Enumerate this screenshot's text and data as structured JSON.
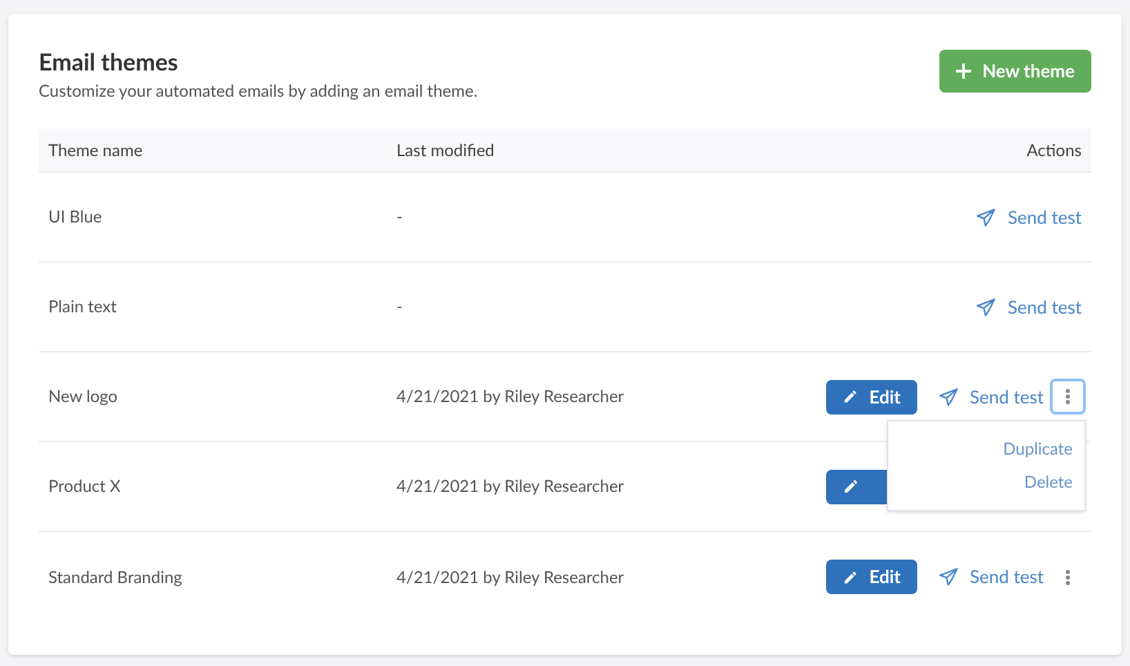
{
  "header": {
    "title": "Email themes",
    "subtitle": "Customize your automated emails by adding an email theme.",
    "new_button": "New theme"
  },
  "table": {
    "columns": [
      "Theme name",
      "Last modified",
      "Actions"
    ],
    "rows": [
      {
        "name": "UI Blue",
        "modified": "-",
        "actions": [
          {
            "kind": "send",
            "label": "Send test"
          }
        ]
      },
      {
        "name": "Plain text",
        "modified": "-",
        "actions": [
          {
            "kind": "send",
            "label": "Send test"
          }
        ]
      },
      {
        "name": "New logo",
        "modified": "4/21/2021 by Riley Researcher",
        "actions": [
          {
            "kind": "edit",
            "label": "Edit"
          },
          {
            "kind": "send",
            "label": "Send test"
          },
          {
            "kind": "more",
            "focused": true,
            "menu": [
              "Duplicate",
              "Delete"
            ]
          }
        ]
      },
      {
        "name": "Product X",
        "modified": "4/21/2021 by Riley Researcher",
        "actions": [
          {
            "kind": "edit"
          }
        ]
      },
      {
        "name": "Standard Branding",
        "modified": "4/21/2021 by Riley Researcher",
        "actions": [
          {
            "kind": "edit",
            "label": "Edit"
          },
          {
            "kind": "send",
            "label": "Send test"
          },
          {
            "kind": "more",
            "focused": false
          }
        ]
      }
    ]
  }
}
